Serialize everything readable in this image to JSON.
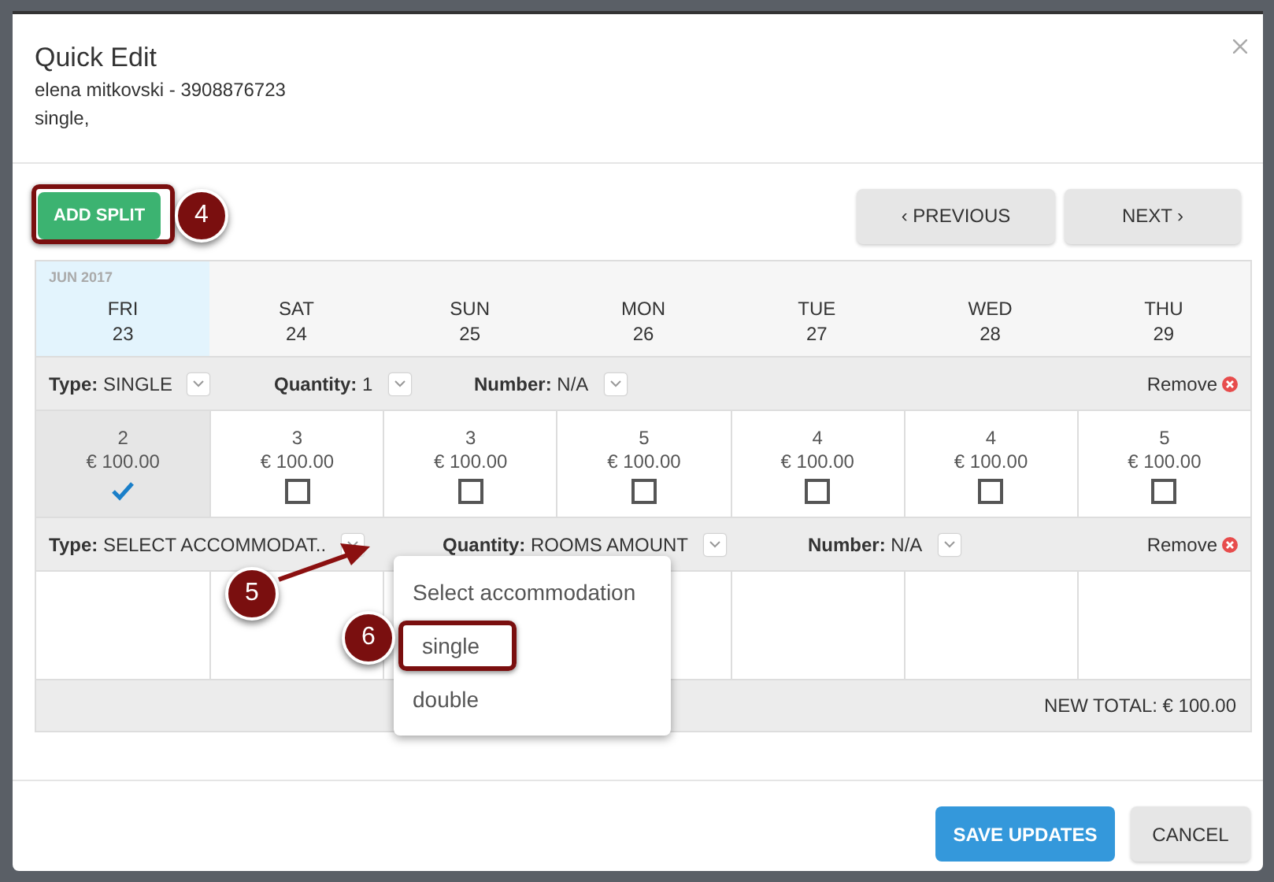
{
  "dialog": {
    "title": "Quick Edit",
    "subtitle_lines": [
      "elena mitkovski - 3908876723",
      "single,"
    ]
  },
  "toolbar": {
    "add_split": "ADD SPLIT",
    "previous": "‹ PREVIOUS",
    "next": "NEXT ›"
  },
  "calendar": {
    "month": "JUN 2017",
    "days": [
      {
        "weekday": "FRI",
        "date": "23",
        "selected": true
      },
      {
        "weekday": "SAT",
        "date": "24",
        "selected": false
      },
      {
        "weekday": "SUN",
        "date": "25",
        "selected": false
      },
      {
        "weekday": "MON",
        "date": "26",
        "selected": false
      },
      {
        "weekday": "TUE",
        "date": "27",
        "selected": false
      },
      {
        "weekday": "WED",
        "date": "28",
        "selected": false
      },
      {
        "weekday": "THU",
        "date": "29",
        "selected": false
      }
    ]
  },
  "splits": [
    {
      "fields": [
        {
          "label": "Type:",
          "value": "SINGLE"
        },
        {
          "label": "Quantity:",
          "value": "1"
        },
        {
          "label": "Number:",
          "value": "N/A"
        }
      ],
      "remove": "Remove",
      "cells": [
        {
          "count": "2",
          "price": "€ 100.00",
          "checked": true
        },
        {
          "count": "3",
          "price": "€ 100.00",
          "checked": false
        },
        {
          "count": "3",
          "price": "€ 100.00",
          "checked": false
        },
        {
          "count": "5",
          "price": "€ 100.00",
          "checked": false
        },
        {
          "count": "4",
          "price": "€ 100.00",
          "checked": false
        },
        {
          "count": "4",
          "price": "€ 100.00",
          "checked": false
        },
        {
          "count": "5",
          "price": "€ 100.00",
          "checked": false
        }
      ]
    },
    {
      "fields": [
        {
          "label": "Type:",
          "value": "SELECT ACCOMMODAT.."
        },
        {
          "label": "Quantity:",
          "value": "ROOMS AMOUNT"
        },
        {
          "label": "Number:",
          "value": "N/A"
        }
      ],
      "remove": "Remove"
    }
  ],
  "total": "NEW TOTAL: € 100.00",
  "dropdown": {
    "options": [
      {
        "label": "Select accommodation",
        "highlighted": false
      },
      {
        "label": "single",
        "highlighted": true
      },
      {
        "label": "double",
        "highlighted": false
      }
    ]
  },
  "footer": {
    "save": "SAVE UPDATES",
    "cancel": "CANCEL"
  },
  "callouts": [
    "4",
    "5",
    "6"
  ]
}
